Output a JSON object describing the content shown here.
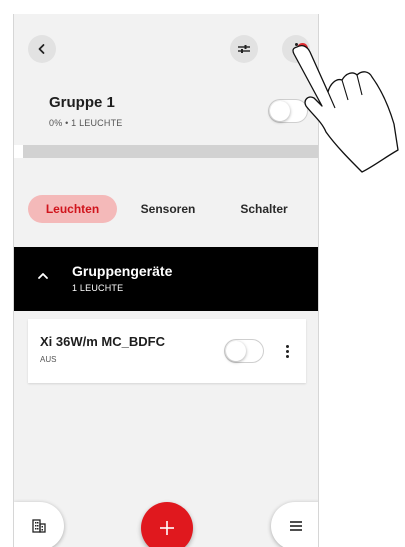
{
  "header": {
    "back_icon": "chevron-left-icon",
    "filter_icon": "sliders-icon",
    "more_icon": "more-vertical-icon"
  },
  "group": {
    "title": "Gruppe 1",
    "subtitle": "0% • 1 LEUCHTE",
    "power_on": false
  },
  "tabs": [
    {
      "label": "Leuchten",
      "active": true
    },
    {
      "label": "Sensoren",
      "active": false
    },
    {
      "label": "Schalter",
      "active": false
    }
  ],
  "group_devices": {
    "title": "Gruppengeräte",
    "subtitle": "1 LEUCHTE",
    "expanded": true
  },
  "device": {
    "name": "Xi 36W/m MC_BDFC",
    "status": "AUS",
    "power_on": false
  },
  "bottom_bar": {
    "left_icon": "building-icon",
    "center_icon": "plus-icon",
    "right_icon": "menu-icon"
  },
  "colors": {
    "accent": "#e0181e",
    "active_tab_bg": "#f4b9b9",
    "active_tab_text": "#d0141c",
    "group_bar_bg": "#000000"
  }
}
